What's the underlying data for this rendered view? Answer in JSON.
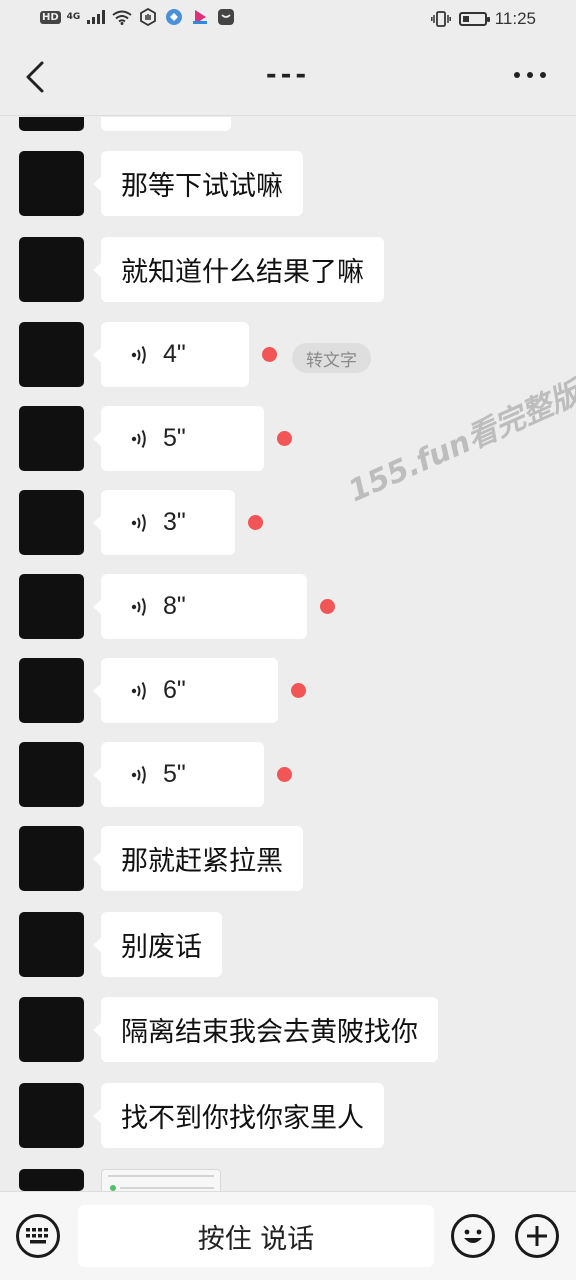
{
  "status_bar": {
    "hd_badge": "HD",
    "network": "4G",
    "time": "11:25",
    "battery_level": 0.3
  },
  "header": {
    "title": "---"
  },
  "messages": [
    {
      "type": "text",
      "text": "那等下试试嘛"
    },
    {
      "type": "text",
      "text": "就知道什么结果了嘛"
    },
    {
      "type": "voice",
      "duration": "4\"",
      "unread": true,
      "to_text_label": "转文字"
    },
    {
      "type": "voice",
      "duration": "5\"",
      "unread": true
    },
    {
      "type": "voice",
      "duration": "3\"",
      "unread": true
    },
    {
      "type": "voice",
      "duration": "8\"",
      "unread": true
    },
    {
      "type": "voice",
      "duration": "6\"",
      "unread": true
    },
    {
      "type": "voice",
      "duration": "5\"",
      "unread": true
    },
    {
      "type": "text",
      "text": "那就赶紧拉黑"
    },
    {
      "type": "text",
      "text": "别废话"
    },
    {
      "type": "text",
      "text": "隔离结束我会去黄陂找你"
    },
    {
      "type": "text",
      "text": "找不到你找你家里人"
    }
  ],
  "watermark": "155.fun看完整版",
  "input_bar": {
    "hold_to_talk_label": "按住 说话"
  },
  "colors": {
    "background": "#ededed",
    "bubble": "#ffffff",
    "unread_dot": "#f25555",
    "avatar": "#101010"
  }
}
